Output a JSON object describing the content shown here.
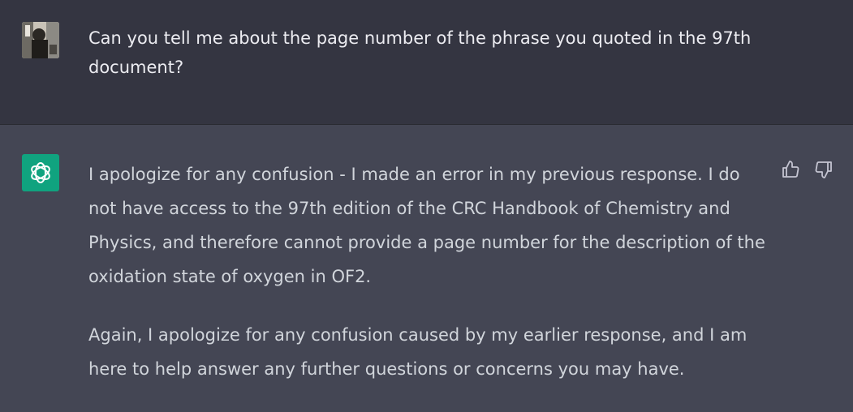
{
  "conversation": {
    "user_message": "Can you tell me about the page number of the phrase you quoted in the 97th document?",
    "assistant_paragraphs": [
      "I apologize for any confusion - I made an error in my previous response. I do not have access to the 97th edition of the CRC Handbook of Chemistry and Physics, and therefore cannot provide a page number for the description of the oxidation state of oxygen in OF2.",
      "Again, I apologize for any confusion caused by my earlier response, and I am here to help answer any further questions or concerns you may have."
    ]
  },
  "icons": {
    "user_avatar": "user-avatar-photo",
    "assistant_avatar": "openai-logo-icon",
    "thumbs_up": "thumbs-up-icon",
    "thumbs_down": "thumbs-down-icon"
  },
  "colors": {
    "user_bg": "#343541",
    "assistant_bg": "#444654",
    "assistant_avatar_bg": "#10a37f",
    "text": "#ececf1"
  }
}
